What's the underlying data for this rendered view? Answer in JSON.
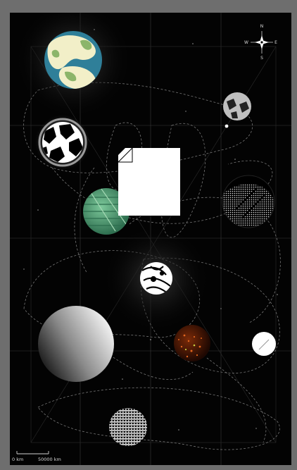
{
  "compass": {
    "north": "N",
    "south": "S",
    "east": "E",
    "west": "W"
  },
  "scale_bar": {
    "start_label": "0 km",
    "end_label": "50000 km"
  },
  "map_features": {
    "planets": [
      {
        "name": "continent-planet-icon",
        "style": "earthlike",
        "colors": [
          "#f2efc8",
          "#2f7f99",
          "#8cb56a"
        ]
      },
      {
        "name": "cracked-rock-planet-icon",
        "style": "cracked",
        "colors": [
          "#ffffff",
          "#000000"
        ]
      },
      {
        "name": "small-grey-moon-icon",
        "style": "speckled",
        "colors": [
          "#bfbfbf",
          "#222222"
        ]
      },
      {
        "name": "green-banded-planet-icon",
        "style": "banded",
        "colors": [
          "#64b482",
          "#2c6e4e"
        ]
      },
      {
        "name": "dotted-gas-planet-icon",
        "style": "halftone",
        "colors": [
          "#e6e6e6",
          "#000000"
        ]
      },
      {
        "name": "central-swirl-planet-icon",
        "style": "swirl",
        "colors": [
          "#ffffff",
          "#000000"
        ]
      },
      {
        "name": "gradient-giant-planet-icon",
        "style": "gradient",
        "colors": [
          "#ffffff",
          "#1a1a1a"
        ]
      },
      {
        "name": "molten-planet-icon",
        "style": "lava",
        "colors": [
          "#e0641e",
          "#3a1206"
        ]
      },
      {
        "name": "small-white-moon-icon",
        "style": "plain",
        "colors": [
          "#ffffff"
        ]
      },
      {
        "name": "striped-planet-icon",
        "style": "striped",
        "colors": [
          "#e8e8e8",
          "#111111"
        ]
      }
    ],
    "placeholder_document": {
      "name": "document-placeholder-icon",
      "color": "#ffffff"
    }
  }
}
